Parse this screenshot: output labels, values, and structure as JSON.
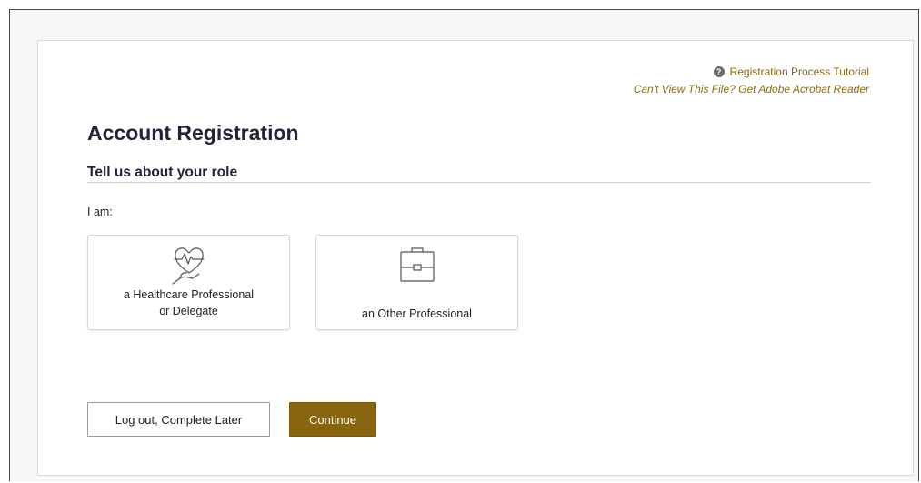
{
  "header": {
    "tutorial_link": "Registration Process Tutorial",
    "acrobat_link": "Can't View This File? Get Adobe Acrobat Reader"
  },
  "page": {
    "title": "Account Registration",
    "section_title": "Tell us about your role",
    "i_am_label": "I am:"
  },
  "roles": [
    {
      "label_line1": "a Healthcare Professional",
      "label_line2": "or Delegate",
      "icon": "heart-hand-icon"
    },
    {
      "label": "an Other Professional",
      "icon": "briefcase-icon"
    }
  ],
  "actions": {
    "logout_label": "Log out, Complete Later",
    "continue_label": "Continue"
  },
  "colors": {
    "accent": "#8a6510",
    "link": "#8a6a10",
    "heading": "#22223a"
  }
}
